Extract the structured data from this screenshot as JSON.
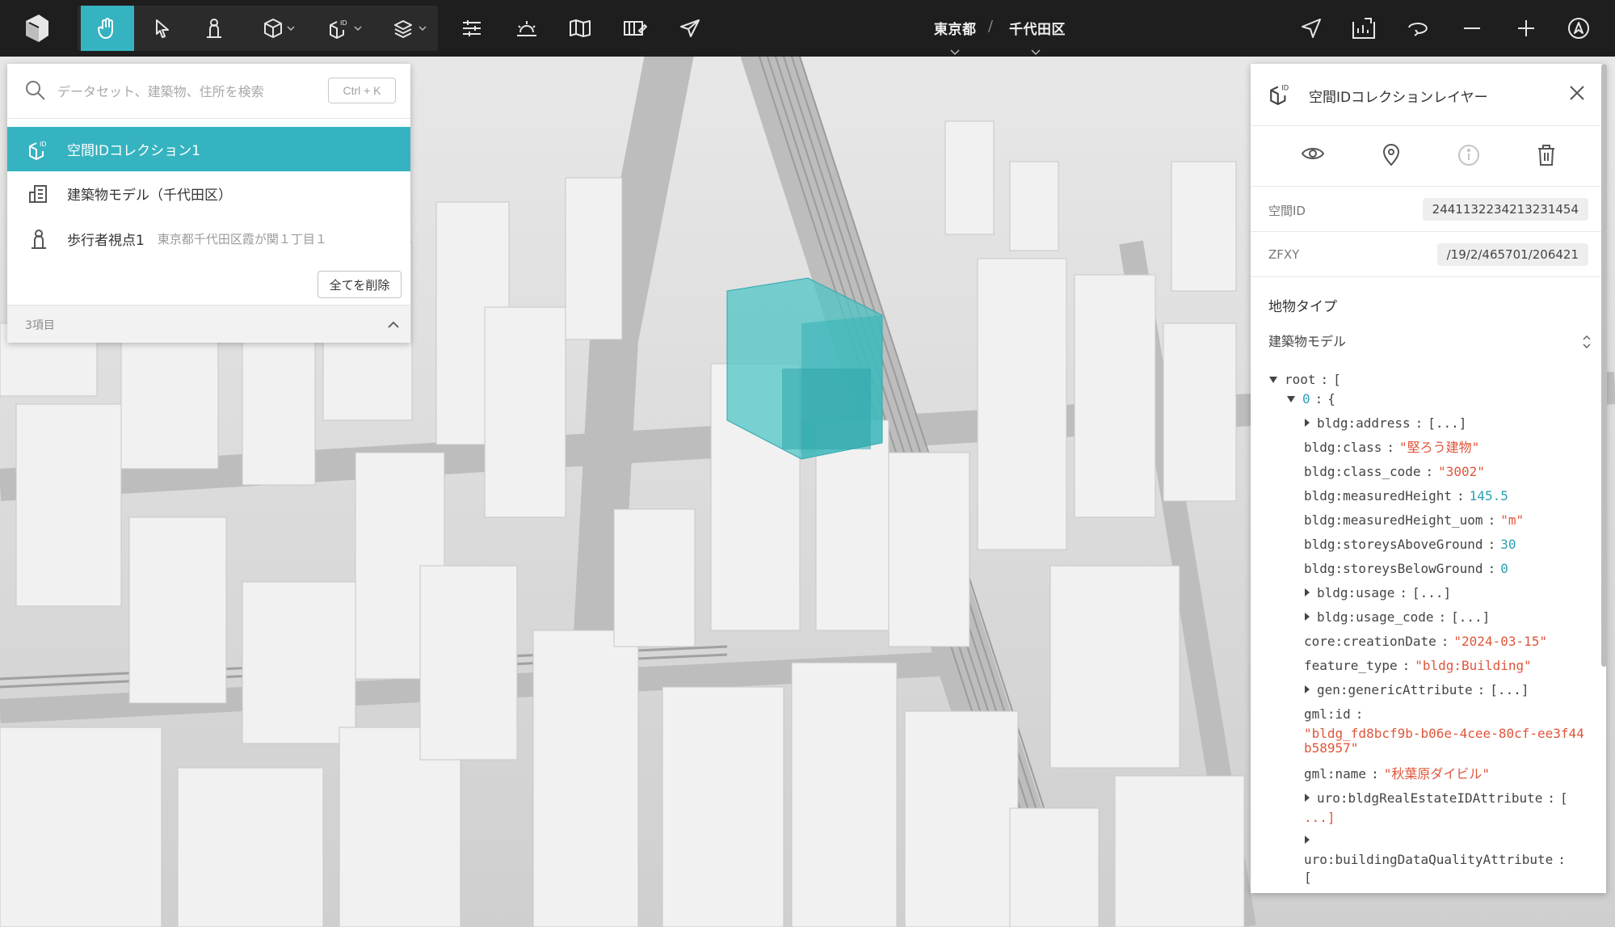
{
  "toolbar": {
    "tools": [
      {
        "name": "hand-tool",
        "active": true
      },
      {
        "name": "select-tool"
      },
      {
        "name": "pedestrian-tool"
      },
      {
        "name": "box-tool",
        "dropdown": true
      },
      {
        "name": "spatial-id-tool",
        "dropdown": true
      },
      {
        "name": "layers-tool",
        "dropdown": true
      }
    ],
    "breadcrumb": {
      "prefecture": "東京都",
      "separator": "/",
      "ward": "千代田区"
    },
    "accent_color": "#36b3c0"
  },
  "search": {
    "placeholder": "データセット、建築物、住所を検索",
    "shortcut": "Ctrl + K",
    "items": [
      {
        "label": "空間IDコレクション1",
        "sub": "",
        "icon": "spatial-id-icon",
        "selected": true
      },
      {
        "label": "建築物モデル（千代田区）",
        "sub": "",
        "icon": "building-model-icon"
      },
      {
        "label": "歩行者視点1",
        "sub": "東京都千代田区霞が関１丁目１",
        "icon": "pedestrian-icon"
      }
    ],
    "clear_all_label": "全てを削除",
    "count_label": "3項目"
  },
  "inspector": {
    "title": "空間IDコレクションレイヤー",
    "properties": [
      {
        "label": "空間ID",
        "value": "2441132234213231454"
      },
      {
        "label": "ZFXY",
        "value": "/19/2/465701/206421"
      }
    ],
    "feature_type_label": "地物タイプ",
    "feature_type_value": "建築物モデル",
    "json": {
      "root_key": "root",
      "root_open": "[",
      "index_key": "0",
      "index_open": "{",
      "colon": ":",
      "collapsed": "[...]",
      "entries": [
        {
          "key": "bldg:address",
          "collapsed": true
        },
        {
          "key": "bldg:class",
          "value": "\"堅ろう建物\"",
          "kind": "string"
        },
        {
          "key": "bldg:class_code",
          "value": "\"3002\"",
          "kind": "string"
        },
        {
          "key": "bldg:measuredHeight",
          "value": "145.5",
          "kind": "number"
        },
        {
          "key": "bldg:measuredHeight_uom",
          "value": "\"m\"",
          "kind": "string"
        },
        {
          "key": "bldg:storeysAboveGround",
          "value": "30",
          "kind": "number"
        },
        {
          "key": "bldg:storeysBelowGround",
          "value": "0",
          "kind": "number"
        },
        {
          "key": "bldg:usage",
          "collapsed": true
        },
        {
          "key": "bldg:usage_code",
          "collapsed": true
        },
        {
          "key": "core:creationDate",
          "value": "\"2024-03-15\"",
          "kind": "string"
        },
        {
          "key": "feature_type",
          "value": "\"bldg:Building\"",
          "kind": "string"
        },
        {
          "key": "gen:genericAttribute",
          "collapsed": true
        },
        {
          "key": "gml:id",
          "value_line1": "\"bldg_fd8bcf9b-b06e-4cee-80cf-ee3f44",
          "value_line2": "b58957\"",
          "kind": "string"
        },
        {
          "key": "gml:name",
          "value": "\"秋葉原ダイビル\"",
          "kind": "string"
        },
        {
          "key": "uro:bldgRealEstateIDAttribute",
          "collapsed": true,
          "wrap_open": "[",
          "wrap_rest": "...]"
        },
        {
          "key": "uro:buildingDataQualityAttribute",
          "partial": true,
          "wrap_open": "["
        }
      ]
    }
  },
  "colors": {
    "toolbar_bg": "#1e1e1e",
    "accent": "#36b3c0",
    "json_string": "#e0553a",
    "json_number": "#2a9fb3",
    "highlight_volume": "#4fc4c6"
  }
}
